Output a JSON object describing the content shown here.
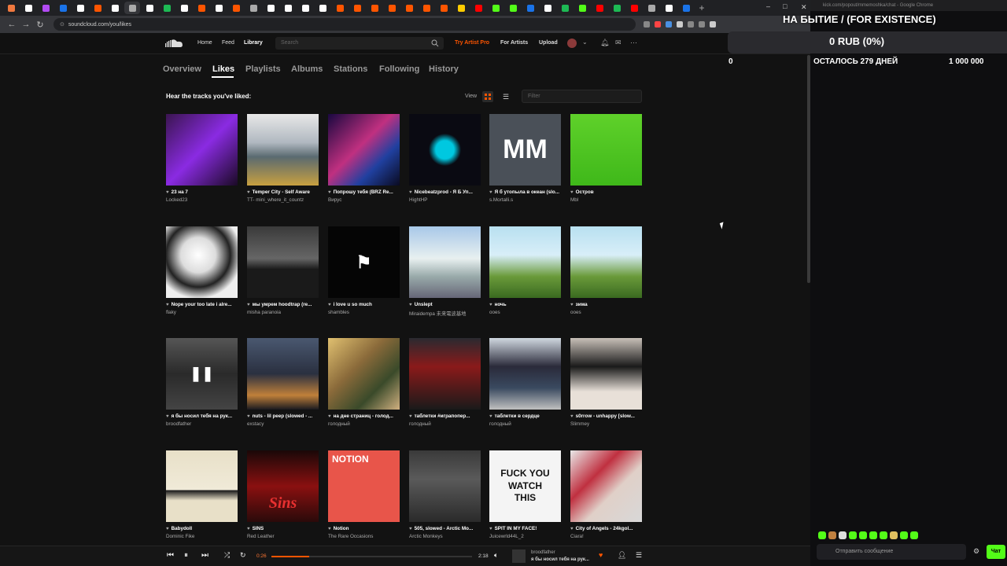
{
  "browser": {
    "url": "soundcloud.com/you/likes",
    "tab_colors": [
      "#f0793f",
      "#ffffff",
      "#b24bf3",
      "#1a73e8",
      "#ffffff",
      "#ff5500",
      "#ffffff",
      "#aaaaaa",
      "#ffffff",
      "#1db954",
      "#ffffff",
      "#ff5500",
      "#ffffff",
      "#ff5500",
      "#aaaaaa",
      "#ffffff",
      "#ffffff",
      "#ffffff",
      "#ffffff",
      "#ff5500",
      "#ff5500",
      "#ff5500",
      "#ff5500",
      "#ff5500",
      "#ff5500",
      "#ff5500",
      "#ffcc00",
      "#ff0000",
      "#53fc18",
      "#53fc18",
      "#1a73e8",
      "#ffffff",
      "#1db954",
      "#53fc18",
      "#ff0000",
      "#1db954",
      "#ff0000",
      "#aaaaaa",
      "#ffffff",
      "#1a73e8"
    ],
    "plus": "+"
  },
  "soundcloud": {
    "nav": {
      "home": "Home",
      "feed": "Feed",
      "library": "Library"
    },
    "search_placeholder": "Search",
    "try_pro": "Try Artist Pro",
    "for_artists": "For Artists",
    "upload": "Upload",
    "tabs": [
      "Overview",
      "Likes",
      "Playlists",
      "Albums",
      "Stations",
      "Following",
      "History"
    ],
    "heading": "Hear the tracks you've liked:",
    "view_label": "View",
    "filter_placeholder": "Filter"
  },
  "tracks": [
    {
      "title": "23 на 7",
      "artist": "Locked23",
      "bg": "linear-gradient(135deg,#3a1550,#8a2be2 50%,#1a0a25)"
    },
    {
      "title": "Temper City - Self Aware",
      "artist": "TT- mini_where_it_countz",
      "bg": "linear-gradient(180deg,#e8e8e8,#b0b8c0 40%,#5a6a70 60%,#c8a040)"
    },
    {
      "title": "Попрошу тебя (BRZ Re...",
      "artist": "Вирус",
      "bg": "linear-gradient(135deg,#1a0840,#c03080 45%,#2040a0 70%,#0a0a20)"
    },
    {
      "title": "Nicebeatzprod - Я Б Уп...",
      "artist": "HightHP",
      "bg": "radial-gradient(circle at 50% 50%,#00c8e0 0,#00c8e0 18%,#0a0a12 32%)"
    },
    {
      "title": "Я б утопыла в океан (slo...",
      "artist": "s.Mortalli.s",
      "bg": "#4a5058",
      "text": "MM"
    },
    {
      "title": "Остров",
      "artist": "Mbl",
      "bg": "linear-gradient(180deg,#5fd12a,#3fb81a)"
    },
    {
      "title": "Nope your too late i alre...",
      "artist": "flaky",
      "bg": "radial-gradient(circle at 45% 40%,#fff 0,#ddd 30%,#222 55%,#eee 75%)"
    },
    {
      "title": "мы умрем hoodtrap (re...",
      "artist": "misha paranoia",
      "bg": "linear-gradient(180deg,#3a3a3a,#666 45%,#1a1a1a 60%)"
    },
    {
      "title": "i love u so much",
      "artist": "shambles",
      "bg": "#050505",
      "text": "⚑"
    },
    {
      "title": "Unslept",
      "artist": "Miraidempa 未来電波基地",
      "bg": "linear-gradient(180deg,#a8c8e8,#e8f0f0 45%,#9aa 70%,#667)"
    },
    {
      "title": "ночь",
      "artist": "ooes",
      "bg": "linear-gradient(180deg,#b8e0f0,#d8eef8 40%,#6a9a3a 70%,#3a6a20)"
    },
    {
      "title": "зима",
      "artist": "ooes",
      "bg": "linear-gradient(180deg,#b8e0f0,#d8eef8 40%,#6a9a3a 70%,#3a6a20)"
    },
    {
      "title": "я бы носил тебя на рук...",
      "artist": "broodfather",
      "bg": "linear-gradient(180deg,#555,#2a2a2a 50%,#444)",
      "text": "❚❚"
    },
    {
      "title": "nuts - lil peep (slowed - ...",
      "artist": "exstacy",
      "bg": "linear-gradient(180deg,#4a5870,#2a3040 50%,#c0803a 80%,#1a1a20)"
    },
    {
      "title": "на дне страниц - голод...",
      "artist": "голодный",
      "bg": "linear-gradient(135deg,#e0c070,#8a6a3a 40%,#3a4a2a 70%,#d0b080)"
    },
    {
      "title": "таблетки #играпопер...",
      "artist": "голодный",
      "bg": "linear-gradient(180deg,#2a2a30,#8a1a1a 40%,#1a1a1a)"
    },
    {
      "title": "таблетки в сердце",
      "artist": "голодный",
      "bg": "linear-gradient(180deg,#d0d8e0,#2a2a3a 40%,#3a4a60 70%,#c0c0c0)"
    },
    {
      "title": "s0rrow - unhappy [slow...",
      "artist": "Slimmey",
      "bg": "linear-gradient(180deg,#c8c0b8,#1a1a1a 40%,#e8e0d8 75%)"
    },
    {
      "title": "Babydoll",
      "artist": "Dominic Fike",
      "bg": "linear-gradient(180deg,#e8e0c8,#f0ead8 55%,#1a1a1a 56%,#e8e0c8 70%)"
    },
    {
      "title": "SINS",
      "artist": "Red Leather",
      "bg": "linear-gradient(180deg,#1a0808,#8a1010 50%,#2a0a0a)",
      "text": "Sins"
    },
    {
      "title": "Notion",
      "artist": "The Rare Occasions",
      "bg": "#e8554a",
      "text": "NOTION"
    },
    {
      "title": "505, slowed - Arctic Mo...",
      "artist": "Arctic Monkeys",
      "bg": "linear-gradient(180deg,#3a3a3a,#5a5a5a 40%,#2a2a2a)"
    },
    {
      "title": "SPIT IN MY FACE!",
      "artist": "Juicewrld44L_2",
      "bg": "#f4f4f4",
      "text": "FUCK YOU WATCH THIS"
    },
    {
      "title": "City of Angels - 24kgol...",
      "artist": "Ciara!",
      "bg": "linear-gradient(135deg,#e8e8e8,#c03040 35%,#e0d0c8 60%,#d8d8d8)"
    }
  ],
  "player": {
    "elapsed": "0:26",
    "duration": "2:18",
    "progress": 0.19,
    "artist": "broodfather",
    "title": "я бы носил тебя на рук..."
  },
  "chat": {
    "window_title": "kick.com/popout/mmemoshka/chat - Google Chrome",
    "goal_title": "НА БЫТИЕ / (FOR EXISTENCE)",
    "goal_amount": "0 RUB (0%)",
    "goal_zero": "0",
    "goal_days": "ОСТАЛОСЬ 279 ДНЕЙ",
    "goal_target": "1 000 000",
    "input_placeholder": "Отправить сообщение",
    "send_label": "Чат"
  }
}
